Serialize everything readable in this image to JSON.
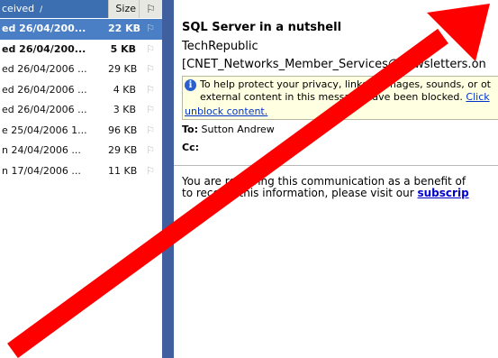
{
  "message_list": {
    "columns": {
      "received": "ceived",
      "sort_glyph": "/",
      "size": "Size",
      "flag_glyph": "⚐"
    },
    "rows": [
      {
        "received": "ed 26/04/200...",
        "size": "22 KB",
        "selected": true,
        "unread": true
      },
      {
        "received": "ed 26/04/200...",
        "size": "5 KB",
        "selected": false,
        "unread": true
      },
      {
        "received": "ed 26/04/2006 ...",
        "size": "29 KB",
        "selected": false,
        "unread": false
      },
      {
        "received": "ed 26/04/2006 ...",
        "size": "4 KB",
        "selected": false,
        "unread": false
      },
      {
        "received": "ed 26/04/2006 ...",
        "size": "3 KB",
        "selected": false,
        "unread": false
      },
      {
        "received": "e 25/04/2006 1...",
        "size": "96 KB",
        "selected": false,
        "unread": false
      },
      {
        "received": "n 24/04/2006 ...",
        "size": "29 KB",
        "selected": false,
        "unread": false
      },
      {
        "received": "n 17/04/2006 ...",
        "size": "11 KB",
        "selected": false,
        "unread": false
      }
    ],
    "flag_glyph": "⚐"
  },
  "reading_pane": {
    "subject": "SQL Server in a nutshell",
    "sender_name": "TechRepublic",
    "sender_email": "[CNET_Networks_Member_Services@newsletters.on",
    "infobar": {
      "icon": "info-icon",
      "line1": "To help protect your privacy, links to images, sounds, or ot",
      "line2_text": "external content in this message have been blocked. ",
      "line2_link": "Click",
      "line3_link": "unblock content."
    },
    "to_label": "To:",
    "to_value": "Sutton Andrew",
    "cc_label": "Cc:",
    "body_line1": "You are receiving this communication as a benefit of",
    "body_line2_text": "to receive this information, please visit our ",
    "body_line2_link": "subscrip"
  },
  "overlay": {
    "arrow_color": "#ff0000",
    "direction": "up-right"
  },
  "colors": {
    "selected_row": "#4a7fc6",
    "divider": "#3f5f9f",
    "infobar": "#ffffe1",
    "link": "#0033cc"
  }
}
